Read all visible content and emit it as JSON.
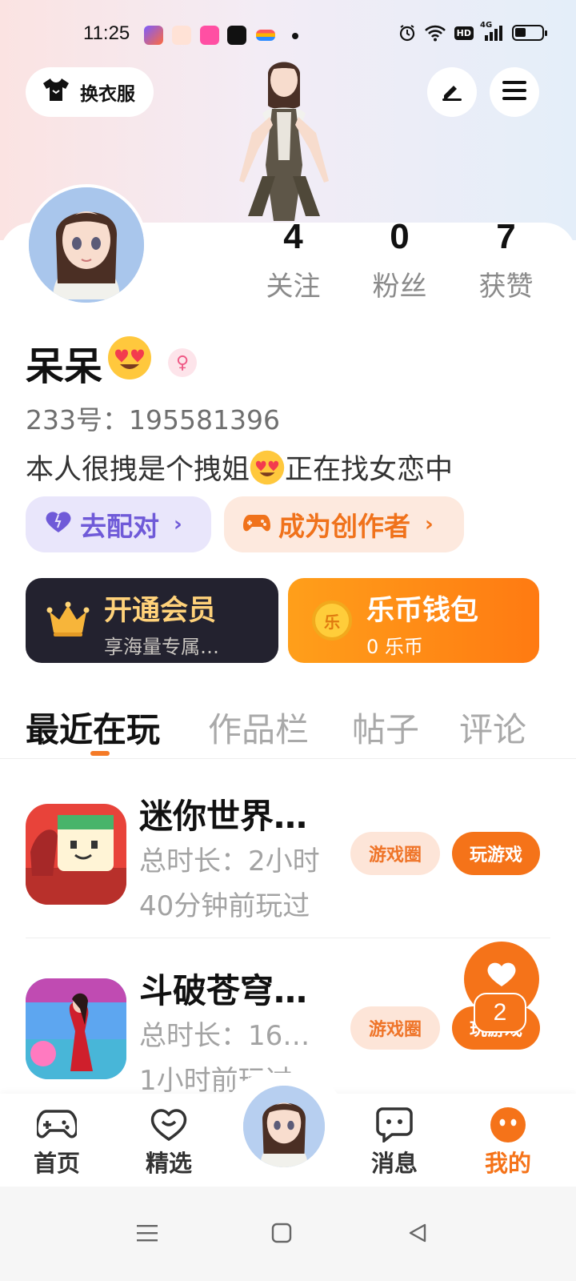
{
  "status_bar": {
    "time": "11:25",
    "network": "4G",
    "hd": "HD"
  },
  "header": {
    "outfit_label": "换衣服"
  },
  "profile": {
    "stats": [
      {
        "value": "4",
        "label": "关注"
      },
      {
        "value": "0",
        "label": "粉丝"
      },
      {
        "value": "7",
        "label": "获赞"
      }
    ],
    "name": "呆呆",
    "id_text": "233号：195581396",
    "bio_part1": "本人很拽是个拽姐",
    "bio_part2": "正在找女恋中"
  },
  "actions": {
    "match_label": "去配对",
    "creator_label": "成为创作者"
  },
  "cards": {
    "vip_title": "开通会员",
    "vip_sub": "享海量专属…",
    "wallet_title": "乐币钱包",
    "wallet_sub": "0 乐币",
    "coin_glyph": "乐"
  },
  "tabs": [
    "最近在玩",
    "作品栏",
    "帖子",
    "评论"
  ],
  "games": [
    {
      "name": "迷你世界…",
      "duration": "总时长：2小时",
      "last_played": "40分钟前玩过",
      "circle_label": "游戏圈",
      "play_label": "玩游戏"
    },
    {
      "name": "斗破苍穹…",
      "duration": "总时长：16…",
      "last_played": "1小时前玩过",
      "circle_label": "游戏圈",
      "play_label": "玩游戏"
    }
  ],
  "float_like": {
    "count": "2"
  },
  "bottom_nav": [
    {
      "label": "首页",
      "icon": "gamepad-icon"
    },
    {
      "label": "精选",
      "icon": "heart-chat-icon"
    },
    {
      "label": "消息",
      "icon": "message-icon"
    },
    {
      "label": "我的",
      "icon": "profile-face-icon",
      "active": true
    }
  ],
  "colors": {
    "accent": "#F57319",
    "vip_bg": "#23222F",
    "match_purple": "#6F5AD8"
  }
}
